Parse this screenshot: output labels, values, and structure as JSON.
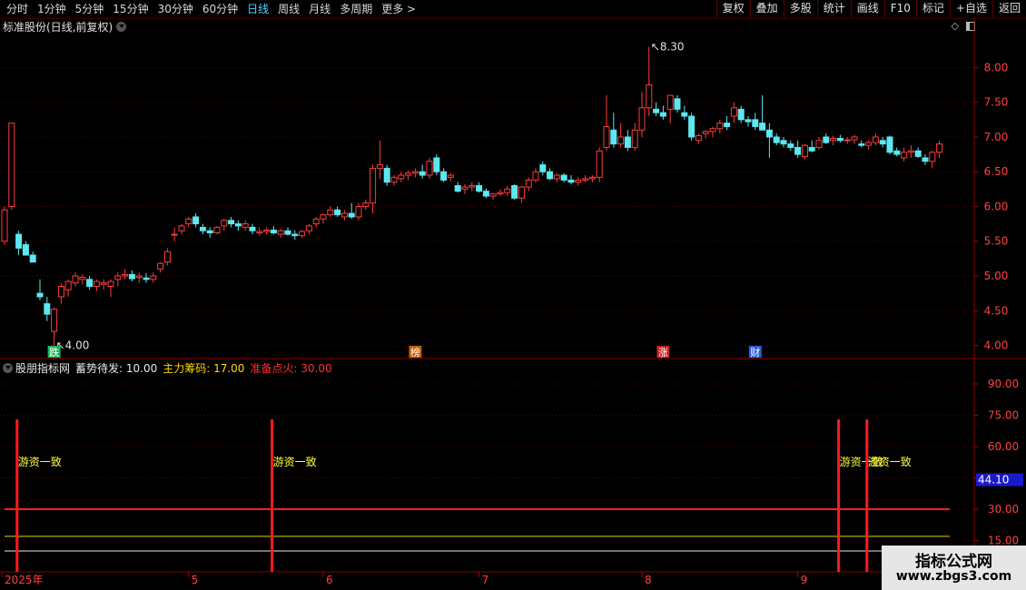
{
  "toolbar": {
    "periods": [
      "分时",
      "1分钟",
      "5分钟",
      "15分钟",
      "30分钟",
      "60分钟",
      "日线",
      "周线",
      "月线",
      "多周期",
      "更多 >"
    ],
    "active_period": "日线",
    "buttons": [
      "复权",
      "叠加",
      "多股",
      "统计",
      "画线",
      "F10",
      "标记",
      "+自选",
      "返回"
    ]
  },
  "main": {
    "title": "标准股份(日线,前复权)",
    "price_ticks": [
      "8.00",
      "7.50",
      "7.00",
      "6.50",
      "6.00",
      "5.50",
      "5.00",
      "4.50",
      "4.00"
    ],
    "high_label": "8.30",
    "low_label": "4.00",
    "markers": [
      {
        "text": "跌",
        "color": "#1fb85a"
      },
      {
        "text": "榜",
        "color": "#c85a00"
      },
      {
        "text": "涨",
        "color": "#c81e1e"
      },
      {
        "text": "财",
        "color": "#2a5ad8"
      }
    ]
  },
  "indicator": {
    "name": "股朋指标网",
    "items": [
      {
        "label": "蓄势待发: 10.00",
        "color": "#e8e8e8"
      },
      {
        "label": "主力筹码: 17.00",
        "color": "#ffd700"
      },
      {
        "label": "准备点火: 30.00",
        "color": "#ff3030"
      }
    ],
    "ticks": [
      "90.00",
      "75.00",
      "60.00",
      "45.00",
      "30.00",
      "15.00"
    ],
    "current_value": "44.10",
    "signal_text": "游资一致"
  },
  "date_axis": [
    "2025年",
    "5",
    "6",
    "7",
    "8",
    "9"
  ],
  "watermark": {
    "line1": "指标公式网",
    "line2": "www.zbgs3.com"
  },
  "chart_data": {
    "type": "candlestick",
    "price_range": [
      3.85,
      8.45
    ],
    "indicator_range": [
      0,
      100
    ],
    "levels": [
      {
        "value": 30,
        "color": "#ff2020"
      },
      {
        "value": 17,
        "color": "#d8d800"
      },
      {
        "value": 10,
        "color": "#e8e8e8"
      }
    ],
    "signal_bars": [
      1,
      37,
      117,
      121
    ],
    "colors": {
      "up": "#ff3c3c",
      "down": "#5ce8f0"
    },
    "ohlc": [
      [
        5.5,
        6.0,
        5.45,
        5.95
      ],
      [
        6.0,
        7.2,
        5.95,
        7.2
      ],
      [
        5.6,
        5.65,
        5.3,
        5.4
      ],
      [
        5.45,
        5.5,
        5.3,
        5.3
      ],
      [
        5.3,
        5.35,
        5.2,
        5.2
      ],
      [
        4.75,
        4.95,
        4.65,
        4.7
      ],
      [
        4.6,
        4.7,
        4.35,
        4.45
      ],
      [
        4.2,
        4.55,
        4.0,
        4.52
      ],
      [
        4.7,
        4.9,
        4.6,
        4.85
      ],
      [
        4.8,
        4.95,
        4.7,
        4.92
      ],
      [
        4.9,
        5.05,
        4.85,
        5.0
      ],
      [
        4.95,
        5.02,
        4.88,
        4.98
      ],
      [
        4.95,
        5.0,
        4.8,
        4.85
      ],
      [
        4.85,
        4.95,
        4.78,
        4.92
      ],
      [
        4.88,
        4.95,
        4.8,
        4.9
      ],
      [
        4.85,
        4.95,
        4.7,
        4.92
      ],
      [
        4.95,
        5.05,
        4.85,
        5.0
      ],
      [
        5.0,
        5.1,
        4.95,
        5.02
      ],
      [
        5.02,
        5.08,
        4.92,
        4.96
      ],
      [
        4.98,
        5.05,
        4.9,
        5.0
      ],
      [
        4.97,
        5.04,
        4.9,
        4.95
      ],
      [
        4.95,
        5.05,
        4.9,
        5.0
      ],
      [
        5.1,
        5.2,
        5.05,
        5.18
      ],
      [
        5.2,
        5.4,
        5.15,
        5.35
      ],
      [
        5.6,
        5.7,
        5.5,
        5.6
      ],
      [
        5.65,
        5.75,
        5.6,
        5.72
      ],
      [
        5.75,
        5.85,
        5.7,
        5.82
      ],
      [
        5.85,
        5.9,
        5.7,
        5.75
      ],
      [
        5.7,
        5.75,
        5.6,
        5.65
      ],
      [
        5.65,
        5.7,
        5.55,
        5.62
      ],
      [
        5.62,
        5.72,
        5.6,
        5.7
      ],
      [
        5.72,
        5.82,
        5.65,
        5.8
      ],
      [
        5.8,
        5.85,
        5.7,
        5.75
      ],
      [
        5.75,
        5.8,
        5.65,
        5.72
      ],
      [
        5.7,
        5.8,
        5.65,
        5.75
      ],
      [
        5.7,
        5.75,
        5.6,
        5.65
      ],
      [
        5.62,
        5.7,
        5.58,
        5.64
      ],
      [
        5.64,
        5.7,
        5.6,
        5.66
      ],
      [
        5.66,
        5.72,
        5.6,
        5.62
      ],
      [
        5.6,
        5.68,
        5.55,
        5.65
      ],
      [
        5.65,
        5.7,
        5.58,
        5.6
      ],
      [
        5.6,
        5.66,
        5.52,
        5.58
      ],
      [
        5.58,
        5.66,
        5.55,
        5.64
      ],
      [
        5.65,
        5.75,
        5.6,
        5.72
      ],
      [
        5.75,
        5.85,
        5.7,
        5.82
      ],
      [
        5.82,
        5.9,
        5.75,
        5.88
      ],
      [
        5.88,
        6.0,
        5.85,
        5.95
      ],
      [
        5.95,
        6.0,
        5.85,
        5.88
      ],
      [
        5.85,
        5.95,
        5.8,
        5.9
      ],
      [
        5.9,
        6.05,
        5.82,
        5.85
      ],
      [
        5.85,
        6.05,
        5.8,
        6.0
      ],
      [
        6.0,
        6.1,
        5.95,
        6.05
      ],
      [
        6.05,
        6.6,
        5.9,
        6.55
      ],
      [
        6.55,
        6.95,
        6.4,
        6.6
      ],
      [
        6.55,
        6.6,
        6.3,
        6.35
      ],
      [
        6.35,
        6.45,
        6.3,
        6.42
      ],
      [
        6.4,
        6.5,
        6.35,
        6.45
      ],
      [
        6.45,
        6.52,
        6.38,
        6.48
      ],
      [
        6.48,
        6.55,
        6.42,
        6.5
      ],
      [
        6.5,
        6.6,
        6.4,
        6.45
      ],
      [
        6.45,
        6.7,
        6.4,
        6.65
      ],
      [
        6.7,
        6.75,
        6.45,
        6.5
      ],
      [
        6.5,
        6.55,
        6.35,
        6.38
      ],
      [
        6.42,
        6.48,
        6.36,
        6.45
      ],
      [
        6.3,
        6.35,
        6.2,
        6.22
      ],
      [
        6.25,
        6.32,
        6.18,
        6.28
      ],
      [
        6.28,
        6.35,
        6.22,
        6.3
      ],
      [
        6.3,
        6.35,
        6.2,
        6.22
      ],
      [
        6.22,
        6.26,
        6.12,
        6.15
      ],
      [
        6.15,
        6.2,
        6.1,
        6.18
      ],
      [
        6.18,
        6.25,
        6.15,
        6.2
      ],
      [
        6.2,
        6.3,
        6.15,
        6.25
      ],
      [
        6.3,
        6.32,
        6.1,
        6.12
      ],
      [
        6.12,
        6.3,
        6.05,
        6.28
      ],
      [
        6.28,
        6.42,
        6.22,
        6.38
      ],
      [
        6.38,
        6.55,
        6.35,
        6.5
      ],
      [
        6.6,
        6.65,
        6.45,
        6.5
      ],
      [
        6.5,
        6.55,
        6.38,
        6.4
      ],
      [
        6.4,
        6.48,
        6.35,
        6.45
      ],
      [
        6.45,
        6.48,
        6.35,
        6.38
      ],
      [
        6.38,
        6.45,
        6.32,
        6.35
      ],
      [
        6.35,
        6.42,
        6.3,
        6.38
      ],
      [
        6.38,
        6.45,
        6.35,
        6.4
      ],
      [
        6.4,
        6.45,
        6.35,
        6.42
      ],
      [
        6.42,
        6.85,
        6.35,
        6.8
      ],
      [
        6.85,
        7.6,
        6.8,
        7.15
      ],
      [
        7.1,
        7.35,
        6.85,
        6.9
      ],
      [
        6.9,
        7.2,
        6.85,
        7.0
      ],
      [
        7.0,
        7.1,
        6.8,
        6.85
      ],
      [
        6.85,
        7.2,
        6.8,
        7.1
      ],
      [
        7.1,
        7.65,
        7.0,
        7.42
      ],
      [
        7.42,
        8.3,
        7.3,
        7.75
      ],
      [
        7.4,
        7.5,
        7.3,
        7.35
      ],
      [
        7.35,
        7.45,
        7.25,
        7.3
      ],
      [
        7.4,
        7.6,
        7.2,
        7.6
      ],
      [
        7.55,
        7.6,
        7.35,
        7.4
      ],
      [
        7.35,
        7.45,
        7.25,
        7.3
      ],
      [
        7.3,
        7.35,
        6.95,
        7.0
      ],
      [
        6.95,
        7.05,
        6.9,
        7.02
      ],
      [
        7.05,
        7.1,
        6.98,
        7.08
      ],
      [
        7.08,
        7.15,
        7.0,
        7.12
      ],
      [
        7.12,
        7.25,
        7.05,
        7.2
      ],
      [
        7.2,
        7.3,
        7.1,
        7.15
      ],
      [
        7.3,
        7.5,
        7.2,
        7.42
      ],
      [
        7.4,
        7.45,
        7.2,
        7.25
      ],
      [
        7.25,
        7.3,
        7.15,
        7.22
      ],
      [
        7.25,
        7.35,
        7.1,
        7.15
      ],
      [
        7.2,
        7.6,
        7.1,
        7.1
      ],
      [
        7.1,
        7.2,
        6.7,
        7.0
      ],
      [
        7.0,
        7.05,
        6.88,
        6.92
      ],
      [
        6.95,
        7.0,
        6.85,
        6.9
      ],
      [
        6.9,
        6.95,
        6.8,
        6.85
      ],
      [
        6.85,
        6.95,
        6.7,
        6.75
      ],
      [
        6.72,
        6.9,
        6.68,
        6.88
      ],
      [
        6.85,
        6.95,
        6.78,
        6.8
      ],
      [
        6.85,
        7.0,
        6.82,
        6.95
      ],
      [
        7.0,
        7.05,
        6.9,
        6.92
      ],
      [
        6.95,
        7.02,
        6.88,
        6.98
      ],
      [
        6.98,
        7.03,
        6.92,
        6.95
      ],
      [
        6.95,
        7.0,
        6.9,
        6.96
      ],
      [
        6.96,
        7.03,
        6.9,
        7.0
      ],
      [
        6.9,
        6.95,
        6.85,
        6.88
      ],
      [
        6.88,
        6.95,
        6.82,
        6.92
      ],
      [
        6.92,
        7.05,
        6.88,
        7.0
      ],
      [
        6.95,
        7.0,
        6.85,
        6.9
      ],
      [
        7.0,
        7.02,
        6.75,
        6.78
      ],
      [
        6.8,
        6.85,
        6.72,
        6.75
      ],
      [
        6.7,
        6.85,
        6.65,
        6.78
      ],
      [
        6.78,
        6.88,
        6.7,
        6.8
      ],
      [
        6.8,
        6.85,
        6.7,
        6.72
      ],
      [
        6.7,
        6.75,
        6.6,
        6.65
      ],
      [
        6.65,
        6.8,
        6.55,
        6.78
      ],
      [
        6.78,
        6.95,
        6.7,
        6.9
      ]
    ]
  }
}
